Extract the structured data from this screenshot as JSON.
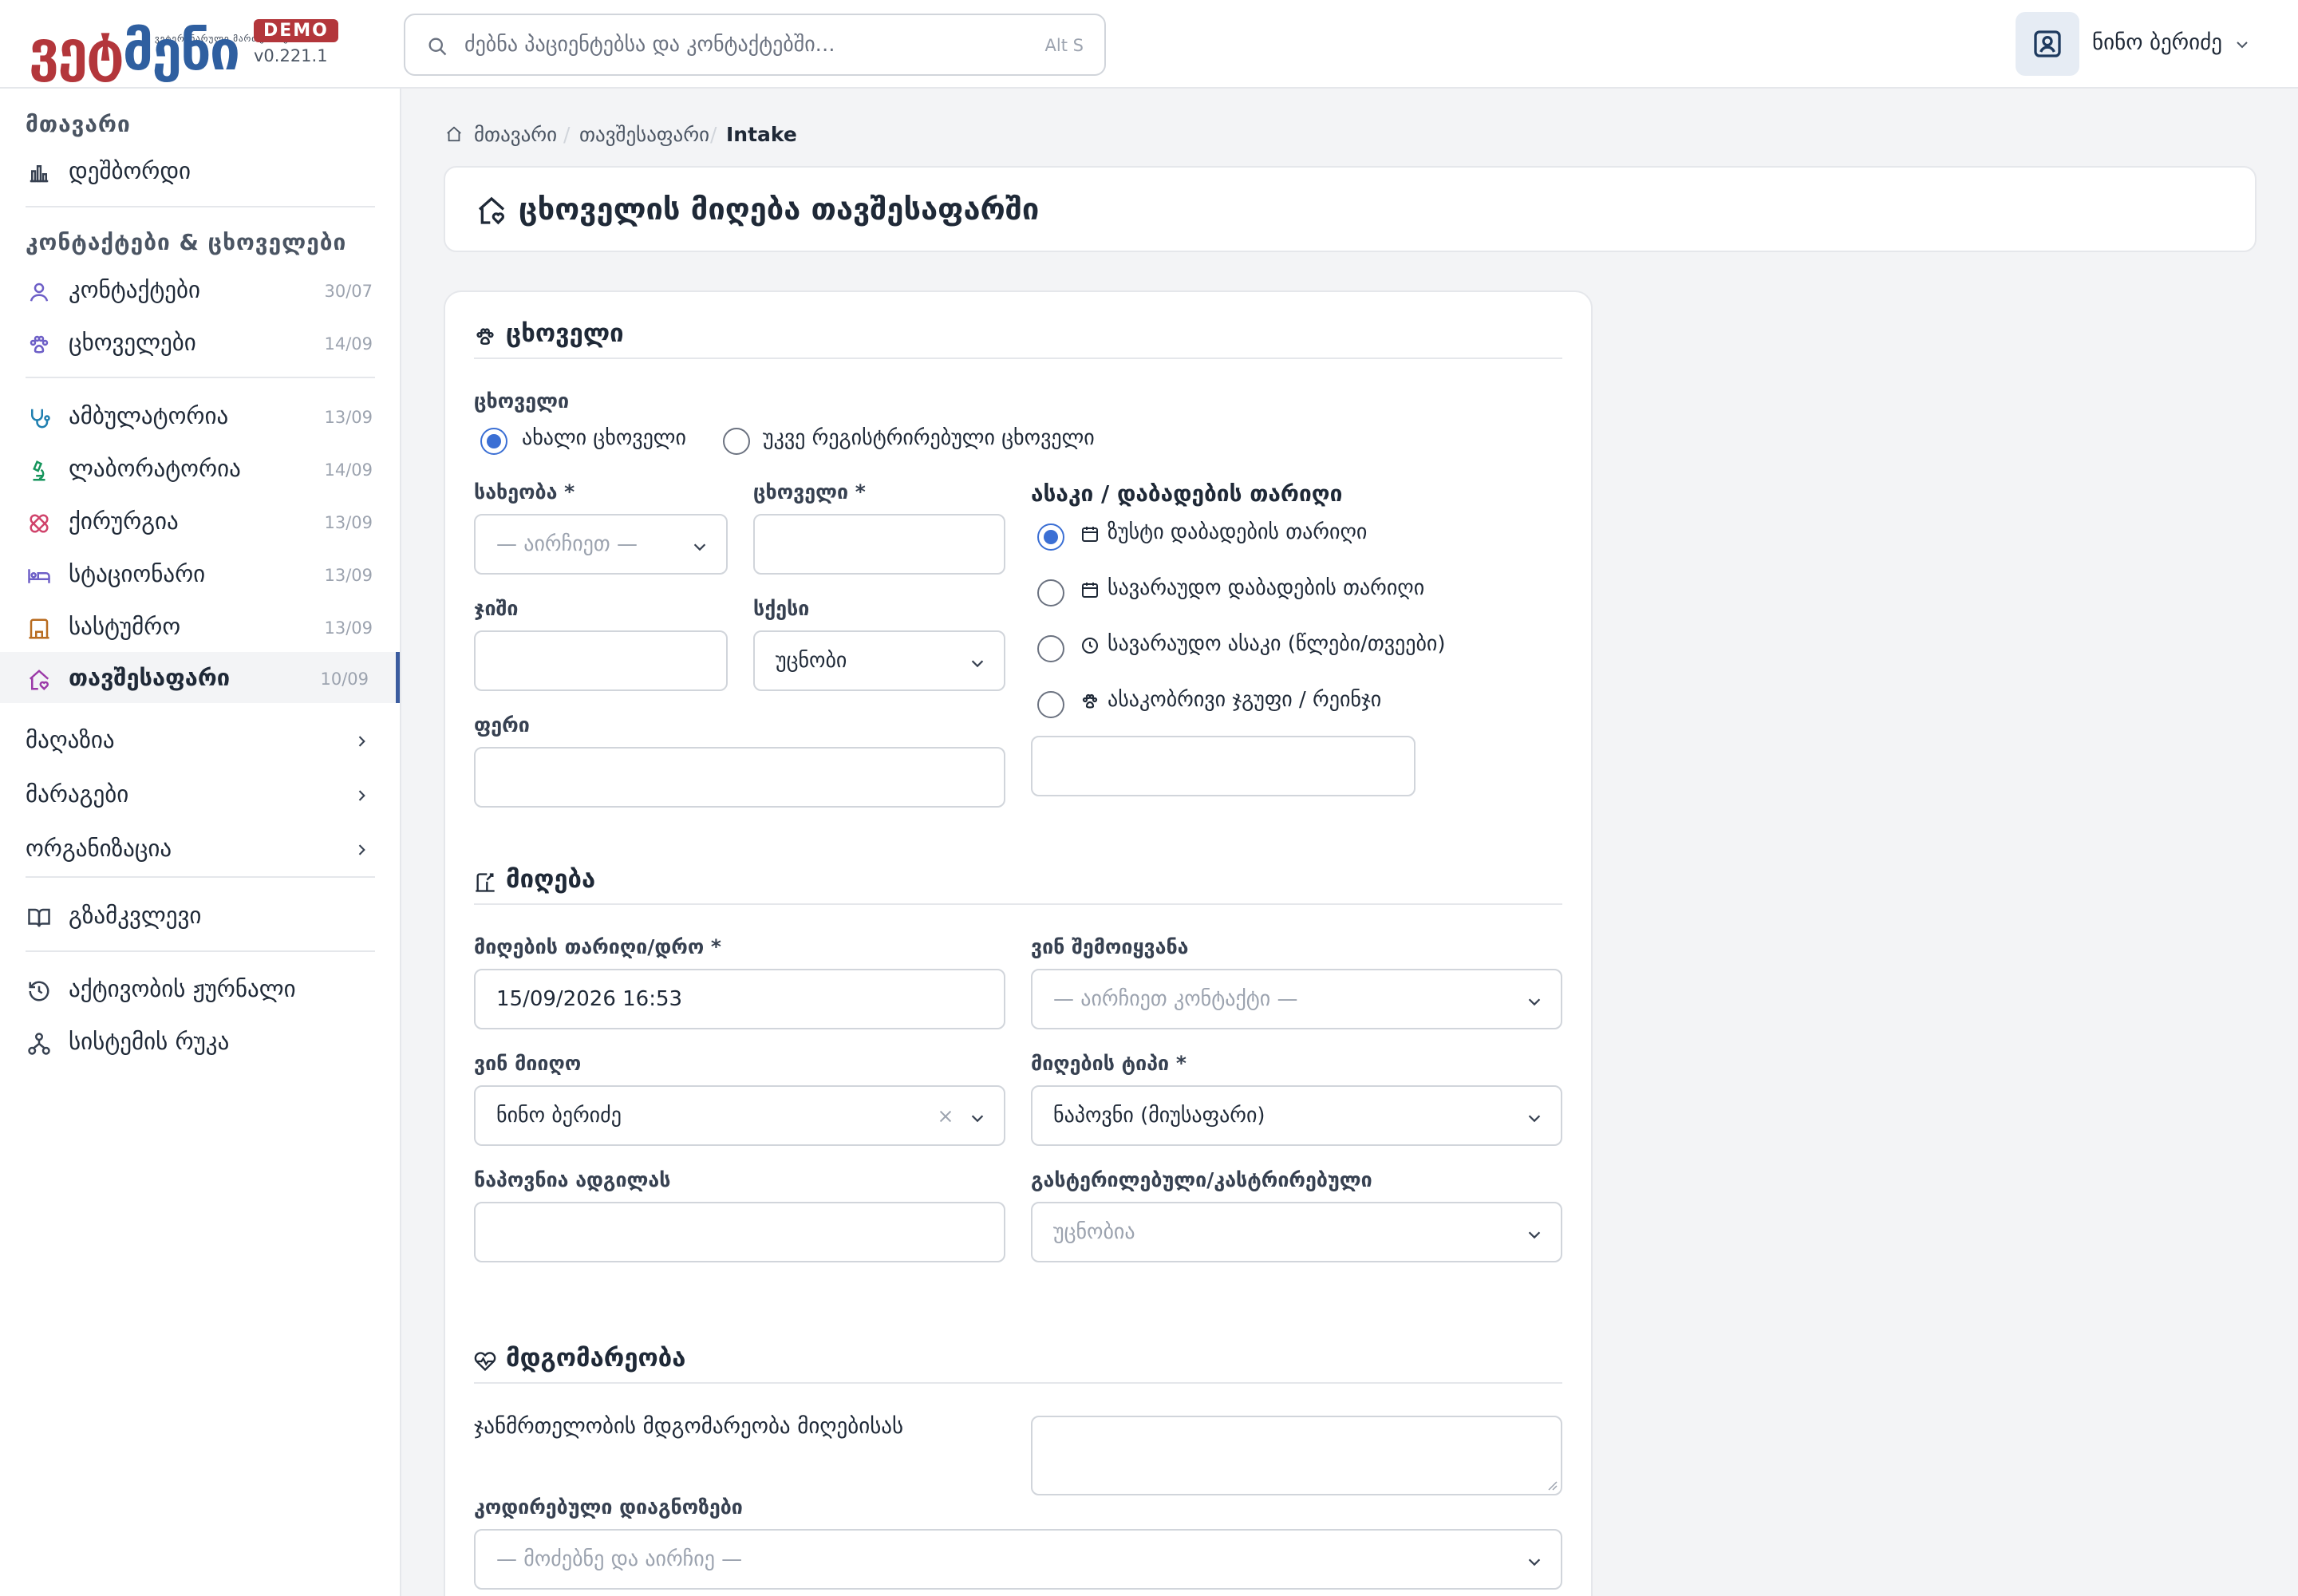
{
  "brand": {
    "logo_sub": "ვეტერინარული მართვისთვის",
    "logo_part1": "ვეტ",
    "logo_part2": "მენი",
    "badge": "DEMO",
    "version": "v0.221.1"
  },
  "search": {
    "placeholder": "ძებნა პაციენტებსა და კონტაქტებში...",
    "shortcut": "Alt S"
  },
  "user": {
    "name": "ნინო ბერიძე"
  },
  "sidebar": {
    "section_main": "მთავარი",
    "dashboard": "დეშბორდი",
    "section_contacts": "კონტაქტები & ცხოველები",
    "items": [
      {
        "label": "კონტაქტები",
        "count": "30/07"
      },
      {
        "label": "ცხოველები",
        "count": "14/09"
      },
      {
        "label": "ამბულატორია",
        "count": "13/09"
      },
      {
        "label": "ლაბორატორია",
        "count": "14/09"
      },
      {
        "label": "ქირურგია",
        "count": "13/09"
      },
      {
        "label": "სტაციონარი",
        "count": "13/09"
      },
      {
        "label": "სასტუმრო",
        "count": "13/09"
      },
      {
        "label": "თავშესაფარი",
        "count": "10/09"
      }
    ],
    "shop": "მაღაზია",
    "inventory": "მარაგები",
    "organization": "ორგანიზაცია",
    "guide": "გზამკვლევი",
    "activity_log": "აქტივობის ჟურნალი",
    "system_map": "სისტემის რუკა"
  },
  "breadcrumb": {
    "home": "მთავარი",
    "shelter": "თავშესაფარი",
    "current": "Intake"
  },
  "page_title": "ცხოველის მიღება თავშესაფარში",
  "animal_section": {
    "title": "ცხოველი",
    "animal_label": "ცხოველი",
    "radio_new": "ახალი ცხოველი",
    "radio_existing": "უკვე რეგისტრირებული ცხოველი",
    "species_label": "სახეობა *",
    "species_placeholder": "— აირჩიეთ —",
    "name_label": "ცხოველი *",
    "breed_label": "ჯიში",
    "sex_label": "სქესი",
    "sex_value": "უცნობი",
    "color_label": "ფერი",
    "age_title": "ასაკი / დაბადების თარიღი",
    "age_exact": "ზუსტი დაბადების თარიღი",
    "age_approx_date": "სავარაუდო დაბადების თარიღი",
    "age_approx_age": "სავარაუდო ასაკი (წლები/თვეები)",
    "age_group": "ასაკობრივი ჯგუფი / რეინჯი"
  },
  "intake_section": {
    "title": "მიღება",
    "date_label": "მიღების თარიღი/დრო *",
    "date_value": "15/09/2026 16:53",
    "brought_by_label": "ვინ შემოიყვანა",
    "brought_by_placeholder": "— აირჩიეთ კონტაქტი —",
    "received_by_label": "ვინ მიიღო",
    "received_by_value": "ნინო ბერიძე",
    "intake_type_label": "მიღების ტიპი *",
    "intake_type_value": "ნაპოვნი (მიუსაფარი)",
    "found_place_label": "ნაპოვნია ადგილას",
    "sterilized_label": "გასტერილებული/კასტრირებული",
    "sterilized_value": "უცნობია"
  },
  "condition_section": {
    "title": "მდგომარეობა",
    "health_label": "ჯანმრთელობის მდგომარეობა მიღებისას",
    "diagnoses_label": "კოდირებული დიაგნოზები",
    "diagnoses_placeholder": "— მოძებნე და აირჩიე —"
  },
  "colors": {
    "accent": "#3b6fd4",
    "brand_red": "#b3363b",
    "brand_blue": "#2f5fa0"
  }
}
